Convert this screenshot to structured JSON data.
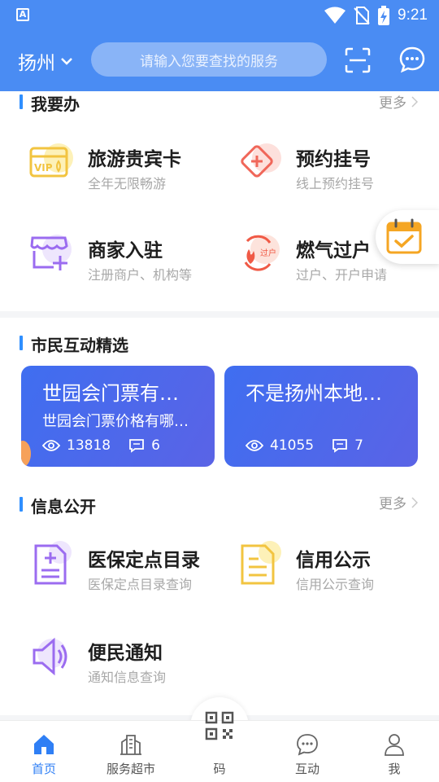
{
  "status_bar": {
    "time": "9:21",
    "app_badge": "A"
  },
  "header": {
    "city": "扬州",
    "search_placeholder": "请输入您要查找的服务"
  },
  "section_todo": {
    "title": "我要办",
    "more": "更多",
    "items": [
      {
        "title": "旅游贵宾卡",
        "subtitle": "全年无限畅游",
        "icon": "vip-card-icon"
      },
      {
        "title": "预约挂号",
        "subtitle": "线上预约挂号",
        "icon": "medical-diamond-icon"
      },
      {
        "title": "商家入驻",
        "subtitle": "注册商户、机构等",
        "icon": "store-add-icon"
      },
      {
        "title": "燃气过户",
        "subtitle": "过户、开户申请",
        "icon": "gas-transfer-icon"
      }
    ],
    "transfer_badge": "过户"
  },
  "section_interaction": {
    "title": "市民互动精选",
    "cards": [
      {
        "title": "世园会门票有…",
        "subtitle": "世园会门票价格有哪…",
        "views": "13818",
        "comments": "6"
      },
      {
        "title": "不是扬州本地…",
        "subtitle": "",
        "views": "41055",
        "comments": "7"
      }
    ]
  },
  "section_info": {
    "title": "信息公开",
    "more": "更多",
    "items": [
      {
        "title": "医保定点目录",
        "subtitle": "医保定点目录查询",
        "icon": "medical-doc-icon"
      },
      {
        "title": "信用公示",
        "subtitle": "信用公示查询",
        "icon": "credit-doc-icon"
      },
      {
        "title": "便民通知",
        "subtitle": "通知信息查询",
        "icon": "speaker-icon"
      }
    ]
  },
  "tabbar": {
    "items": [
      {
        "label": "首页",
        "icon": "home-icon",
        "active": true
      },
      {
        "label": "服务超市",
        "icon": "building-icon",
        "active": false
      },
      {
        "label": "码",
        "icon": "qr-code-icon",
        "active": false
      },
      {
        "label": "互动",
        "icon": "chat-icon",
        "active": false
      },
      {
        "label": "我",
        "icon": "user-icon",
        "active": false
      }
    ]
  },
  "colors": {
    "header_bg": "#4a8cf3",
    "accent": "#2f8fff",
    "tab_active": "#2f7ff5",
    "card_gradient_start": "#3f6ef0",
    "card_gradient_end": "#5a63e6"
  }
}
